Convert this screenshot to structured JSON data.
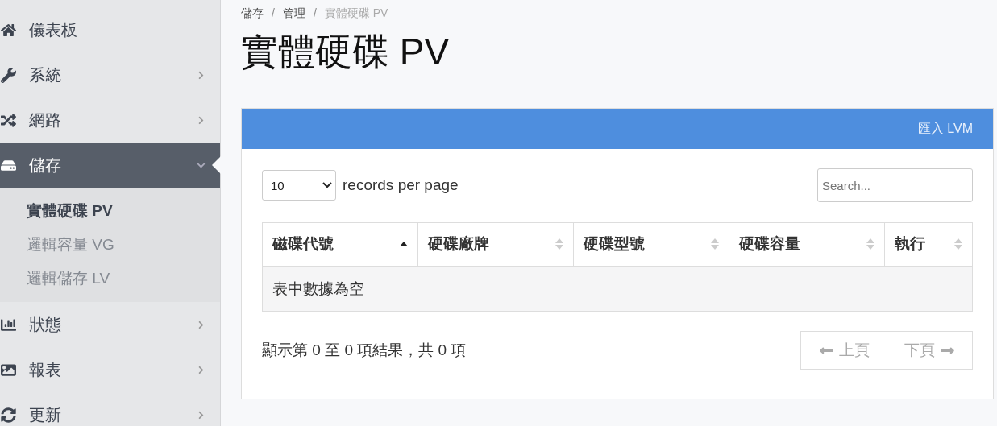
{
  "sidebar": {
    "items": [
      {
        "kind": "link",
        "label": "儀表板",
        "selected": false
      },
      {
        "kind": "menu",
        "label": "系統",
        "expanded": false,
        "selected": false
      },
      {
        "kind": "menu",
        "label": "網路",
        "expanded": false,
        "selected": false
      },
      {
        "kind": "menu",
        "label": "儲存",
        "expanded": true,
        "selected": true,
        "children": [
          {
            "label": "實體硬碟 PV",
            "selected": true
          },
          {
            "label": "邏輯容量 VG",
            "selected": false
          },
          {
            "label": "邏輯儲存 LV",
            "selected": false
          }
        ]
      },
      {
        "kind": "menu",
        "label": "狀態",
        "expanded": false,
        "selected": false
      },
      {
        "kind": "menu",
        "label": "報表",
        "expanded": false,
        "selected": false
      },
      {
        "kind": "menu",
        "label": "更新",
        "expanded": false,
        "selected": false
      }
    ]
  },
  "breadcrumb": {
    "separator": "/",
    "items": [
      {
        "label": "儲存",
        "current": false
      },
      {
        "label": "管理",
        "current": false
      },
      {
        "label": "實體硬碟 PV",
        "current": true
      }
    ]
  },
  "page_title": "實體硬碟 PV",
  "panel": {
    "header_action": "匯入 LVM",
    "page_size": {
      "value": "10",
      "suffix": "records per page"
    },
    "search": {
      "placeholder": "Search..."
    },
    "table": {
      "columns": [
        {
          "label": "磁碟代號",
          "sorted": true
        },
        {
          "label": "硬碟廠牌",
          "sorted": false
        },
        {
          "label": "硬碟型號",
          "sorted": false
        },
        {
          "label": "硬碟容量",
          "sorted": false
        },
        {
          "label": "執行",
          "sorted": false
        }
      ],
      "empty_message": "表中數據為空"
    },
    "summary": "顯示第 0 至 0 項結果，共 0 項",
    "pagination": [
      {
        "kind": "prev",
        "label": "上頁",
        "disabled": true
      },
      {
        "kind": "next",
        "label": "下頁",
        "disabled": true
      }
    ]
  }
}
